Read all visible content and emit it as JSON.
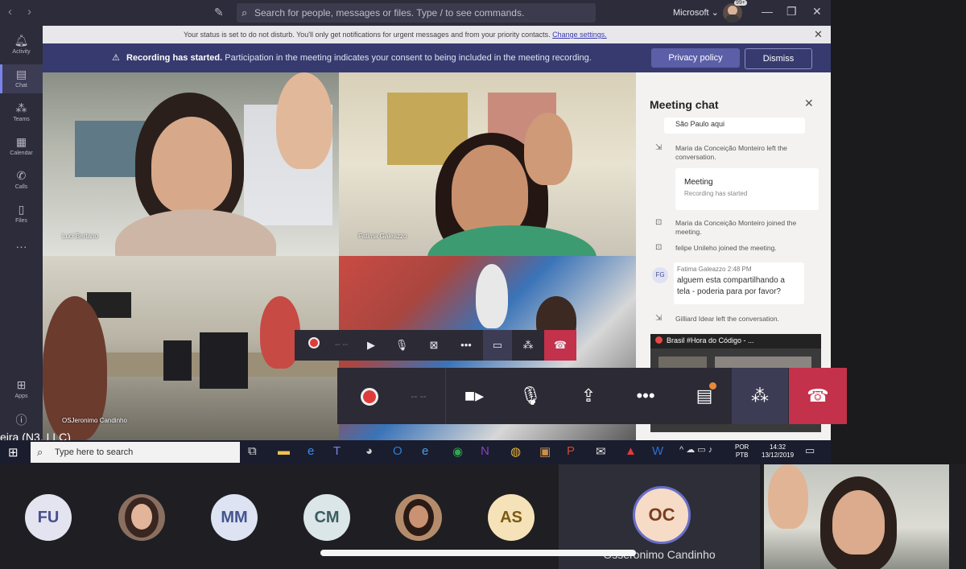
{
  "titlebar": {
    "search_placeholder": "Search for people, messages or files. Type / to see commands.",
    "org": "Microsoft ⌄",
    "avatar_badge": "99+"
  },
  "rail": {
    "items": [
      {
        "label": "Activity",
        "icon": "bell-icon"
      },
      {
        "label": "Chat",
        "icon": "chat-icon"
      },
      {
        "label": "Teams",
        "icon": "teams-icon"
      },
      {
        "label": "Calendar",
        "icon": "calendar-icon"
      },
      {
        "label": "Calls",
        "icon": "phone-icon"
      },
      {
        "label": "Files",
        "icon": "file-icon"
      },
      {
        "label": "Apps",
        "icon": "apps-icon"
      },
      {
        "label": "Help",
        "icon": "help-icon"
      }
    ]
  },
  "dnd_banner": {
    "text": "Your status is set to do not disturb. You'll only get notifications for urgent messages and from your priority contacts.",
    "link": "Change settings."
  },
  "recording_banner": {
    "title": "Recording has started.",
    "text": "Participation in the meeting indicates your consent to being included in the meeting recording.",
    "privacy_label": "Privacy policy",
    "dismiss_label": "Dismiss"
  },
  "tiles": [
    {
      "name": "Luci Bertano"
    },
    {
      "name": "Fatima Galeazzo"
    },
    {
      "name": "OSJeronimo Candinho"
    },
    {
      "name": ""
    }
  ],
  "chat": {
    "title": "Meeting chat",
    "prev_card": "São Paulo aqui",
    "event1": "Maria da Conceição Monteiro left the conversation.",
    "meeting_card_title": "Meeting",
    "meeting_card_sub": "Recording has started",
    "event2": "Maria da Conceição Monteiro joined the meeting.",
    "event3": "felipe Unileho joined the meeting.",
    "msg_initials": "FG",
    "msg_meta": "Fatima Galeazzo  2:48 PM",
    "msg_body": "alguem esta compartilhando a tela - poderia para por favor?",
    "event4": "Gilliard Idear left the conversation.",
    "share_title": "Brasil #Hora do Código - ..."
  },
  "taskbar": {
    "search_placeholder": "Type here to search",
    "lang_line1": "POR",
    "lang_line2": "PTB",
    "time": "14:32",
    "date": "13/12/2019",
    "overlap_name": "eira (N3, LLC)"
  },
  "gallery": {
    "participants": [
      {
        "initials": "FU",
        "bg": "#e4e4f1",
        "fg": "#4b4f8c"
      },
      {
        "initials": "",
        "bg": "#8a6f60",
        "fg": "#fff"
      },
      {
        "initials": "MM",
        "bg": "#dde3f3",
        "fg": "#46548e"
      },
      {
        "initials": "CM",
        "bg": "#dbe6e8",
        "fg": "#3c5d63"
      },
      {
        "initials": "",
        "bg": "#b58c6b",
        "fg": "#fff"
      },
      {
        "initials": "AS",
        "bg": "#f6e2b8",
        "fg": "#7b5a17"
      }
    ],
    "active": {
      "initials": "OC",
      "name": "Osseronimo Candinho"
    }
  },
  "colors": {
    "brand_purple": "#363a6e",
    "hangup_red": "#c4314b",
    "accent": "#6264a7"
  }
}
